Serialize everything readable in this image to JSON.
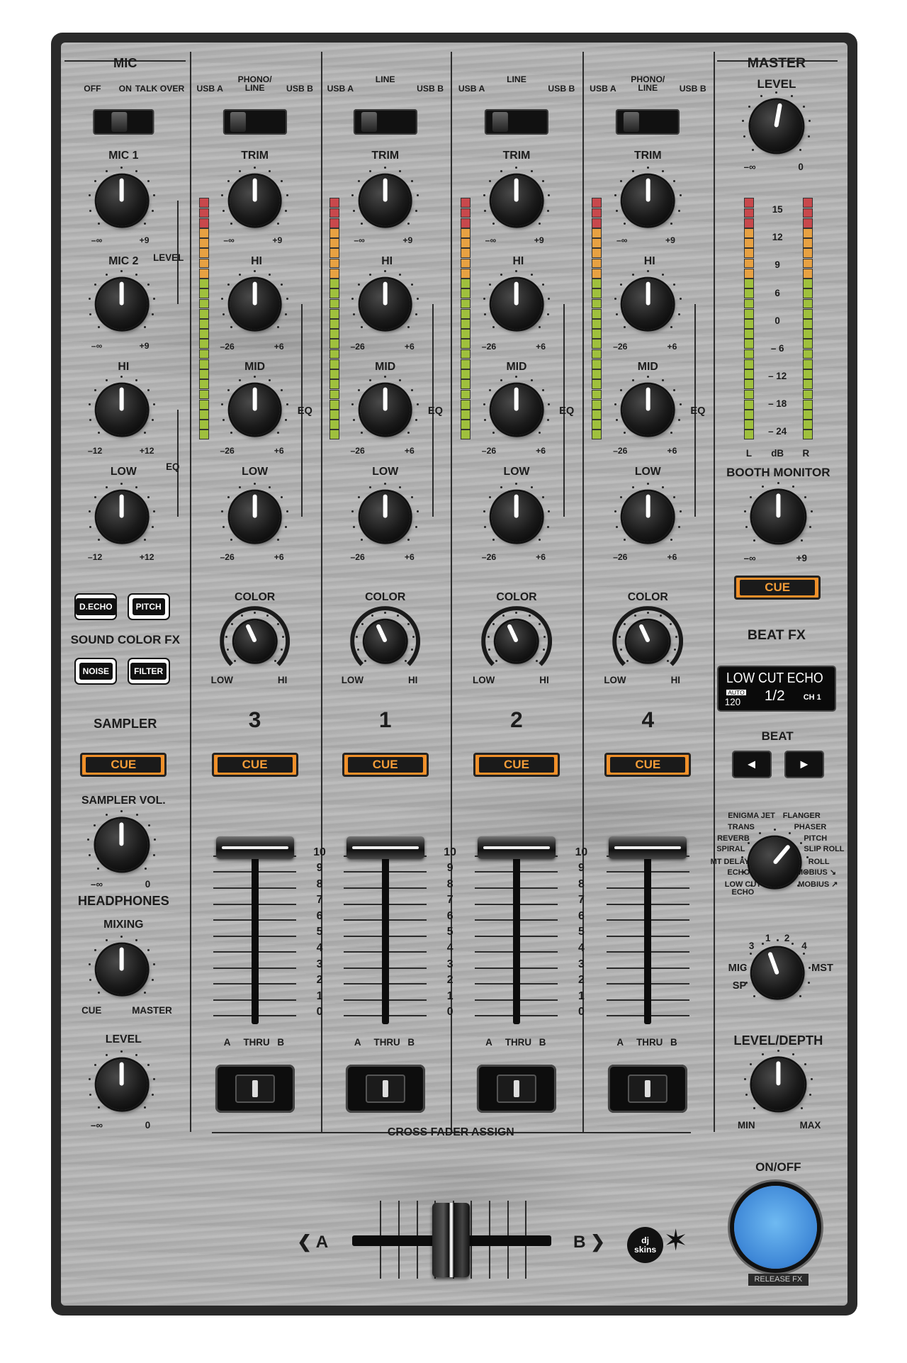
{
  "mic_section": {
    "title": "MIC",
    "switch_labels": [
      "OFF",
      "ON",
      "TALK OVER"
    ],
    "mic1_label": "MIC 1",
    "mic1_min": "–∞",
    "mic1_max": "+9",
    "mic2_label": "MIC 2",
    "mic2_min": "–∞",
    "mic2_max": "+9",
    "level_bracket_label": "LEVEL",
    "hi_label": "HI",
    "hi_min": "–12",
    "hi_max": "+12",
    "low_label": "LOW",
    "low_min": "–12",
    "low_max": "+12",
    "eq_bracket_label": "EQ"
  },
  "sound_color_fx": {
    "title": "SOUND COLOR FX",
    "buttons": [
      "D.ECHO",
      "PITCH",
      "NOISE",
      "FILTER"
    ]
  },
  "sampler": {
    "title": "SAMPLER",
    "cue_label": "CUE",
    "volume_label": "SAMPLER VOL.",
    "volume_min": "–∞",
    "volume_max": "0"
  },
  "headphones": {
    "title": "HEADPHONES",
    "mixing_label": "MIXING",
    "mixing_left": "CUE",
    "mixing_right": "MASTER",
    "level_label": "LEVEL",
    "level_min": "–∞",
    "level_max": "0"
  },
  "channels": [
    {
      "number": "3",
      "source_left": "USB A",
      "source_mid": "PHONO/\nLINE",
      "source_right": "USB B"
    },
    {
      "number": "1",
      "source_left": "USB A",
      "source_mid": "LINE",
      "source_right": "USB B"
    },
    {
      "number": "2",
      "source_left": "USB A",
      "source_mid": "LINE",
      "source_right": "USB B"
    },
    {
      "number": "4",
      "source_left": "USB A",
      "source_mid": "PHONO/\nLINE",
      "source_right": "USB B"
    }
  ],
  "channel_labels": {
    "trim": "TRIM",
    "trim_min": "–∞",
    "trim_max": "+9",
    "hi": "HI",
    "mid": "MID",
    "low": "LOW",
    "eq_min": "–26",
    "eq_max": "+6",
    "eq_bracket": "EQ",
    "color": "COLOR",
    "color_low": "LOW",
    "color_hi": "HI",
    "cue": "CUE",
    "cf_assign_a": "A",
    "cf_assign_thru": "THRU",
    "cf_assign_b": "B"
  },
  "fader_scale": [
    "10",
    "9",
    "8",
    "7",
    "6",
    "5",
    "4",
    "3",
    "2",
    "1",
    "0"
  ],
  "cross_fader": {
    "assign_title": "CROSS FADER ASSIGN",
    "left_label": "❮ A",
    "right_label": "B ❯"
  },
  "master": {
    "title": "MASTER",
    "level_label": "LEVEL",
    "level_min": "–∞",
    "level_max": "0",
    "meter_scale": [
      "15",
      "12",
      "9",
      "6",
      "0",
      "– 6",
      "– 12",
      "– 18",
      "– 24"
    ],
    "meter_left": "L",
    "meter_unit": "dB",
    "meter_right": "R",
    "booth_label": "BOOTH MONITOR",
    "booth_min": "–∞",
    "booth_max": "+9",
    "cue_label": "CUE"
  },
  "beat_fx": {
    "title": "BEAT FX",
    "display_effect": "LOW CUT ECHO",
    "display_auto": "AUTO",
    "display_bpm": "120",
    "display_beat": "1/2",
    "display_channel": "CH 1",
    "beat_label": "BEAT",
    "beat_left_icon": "◄",
    "beat_right_icon": "►",
    "effects_left": [
      "ENIGMA JET",
      "TRANS",
      "REVERB",
      "SPIRAL",
      "MT DELAY",
      "ECHO",
      "LOW CUT\nECHO"
    ],
    "effects_right": [
      "FLANGER",
      "PHASER",
      "PITCH",
      "SLIP ROLL",
      "ROLL",
      "MOBIUS ↘",
      "MOBIUS ↗"
    ],
    "channel_select": [
      "3",
      "1",
      "2",
      "4"
    ],
    "channel_select_mic": "MIC",
    "channel_select_sp": "SP",
    "channel_select_mst": "MST",
    "level_depth_label": "LEVEL/DEPTH",
    "level_depth_min": "MIN",
    "level_depth_max": "MAX",
    "onoff_label": "ON/OFF",
    "release_fx_label": "RELEASE FX",
    "onoff_color": "#6fbaf2"
  },
  "brand": {
    "logo_text": "dj\nskins"
  }
}
